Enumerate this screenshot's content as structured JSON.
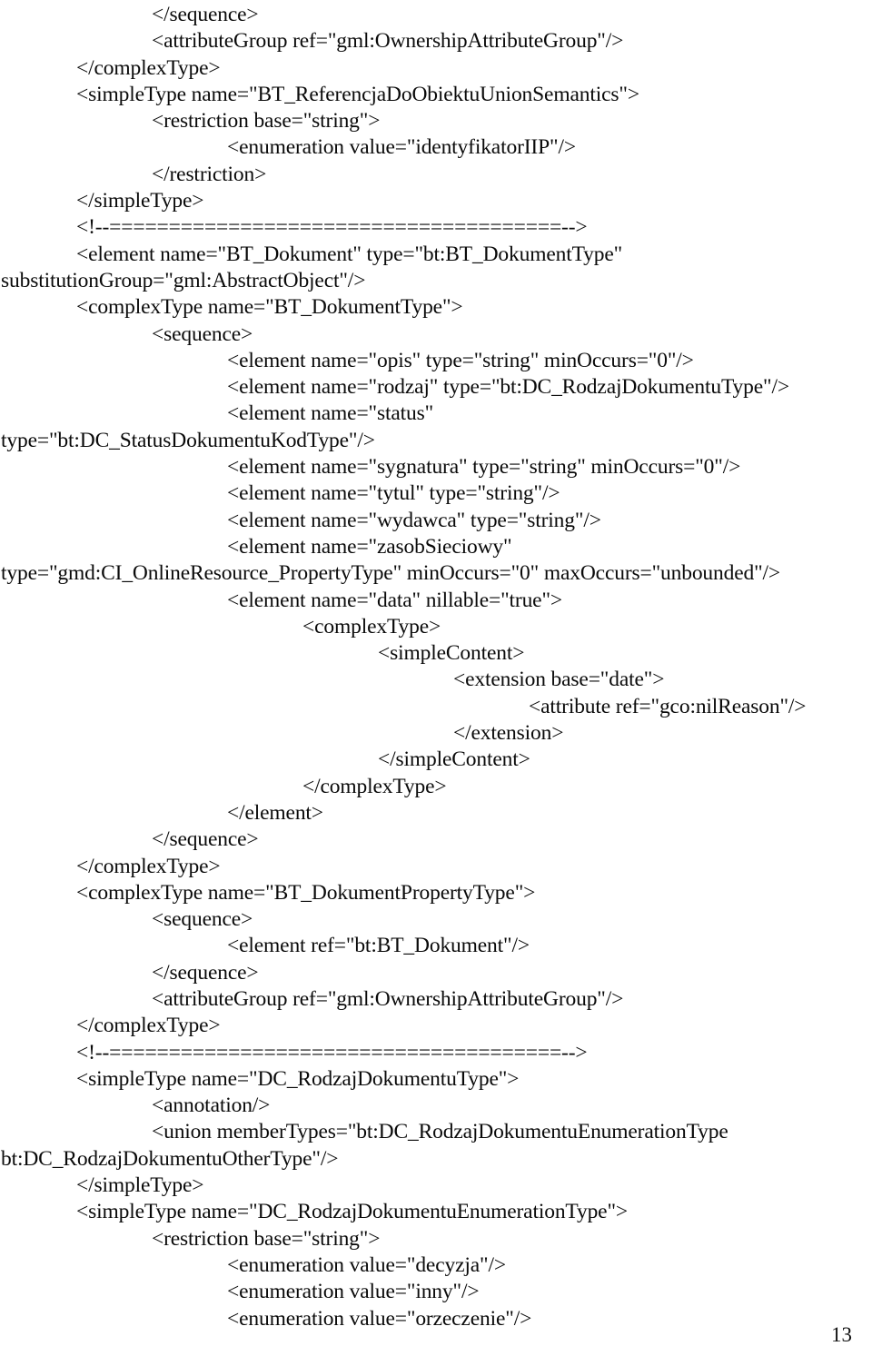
{
  "document": {
    "kind": "scanned-pdf-page",
    "page_number": "13",
    "language": "xml-schema-xsd",
    "lines": [
      {
        "indent": 1,
        "text": "</sequence>"
      },
      {
        "indent": 1,
        "text": "<attributeGroup ref=\"gml:OwnershipAttributeGroup\"/>"
      },
      {
        "indent": 0,
        "text": "</complexType>"
      },
      {
        "indent": 0,
        "text": "<simpleType name=\"BT_ReferencjaDoObiektuUnionSemantics\">"
      },
      {
        "indent": 1,
        "text": "<restriction base=\"string\">"
      },
      {
        "indent": 2,
        "text": "<enumeration value=\"identyfikatorIIP\"/>"
      },
      {
        "indent": 1,
        "text": "</restriction>"
      },
      {
        "indent": 0,
        "text": "</simpleType>"
      },
      {
        "indent": 0,
        "text": "<!--======================================-->"
      },
      {
        "indent": 0,
        "text": "<element name=\"BT_Dokument\" type=\"bt:BT_DokumentType\""
      },
      {
        "indent": -1,
        "text": "substitutionGroup=\"gml:AbstractObject\"/>"
      },
      {
        "indent": 0,
        "text": "<complexType name=\"BT_DokumentType\">"
      },
      {
        "indent": 1,
        "text": "<sequence>"
      },
      {
        "indent": 2,
        "text": "<element name=\"opis\" type=\"string\" minOccurs=\"0\"/>"
      },
      {
        "indent": 2,
        "text": "<element name=\"rodzaj\" type=\"bt:DC_RodzajDokumentuType\"/>"
      },
      {
        "indent": 2,
        "text": "<element name=\"status\""
      },
      {
        "indent": -1,
        "text": "type=\"bt:DC_StatusDokumentuKodType\"/>"
      },
      {
        "indent": 2,
        "text": "<element name=\"sygnatura\" type=\"string\" minOccurs=\"0\"/>"
      },
      {
        "indent": 2,
        "text": "<element name=\"tytul\" type=\"string\"/>"
      },
      {
        "indent": 2,
        "text": "<element name=\"wydawca\" type=\"string\"/>"
      },
      {
        "indent": 2,
        "text": "<element name=\"zasobSieciowy\""
      },
      {
        "indent": -1,
        "text": "type=\"gmd:CI_OnlineResource_PropertyType\" minOccurs=\"0\" maxOccurs=\"unbounded\"/>"
      },
      {
        "indent": 2,
        "text": "<element name=\"data\" nillable=\"true\">"
      },
      {
        "indent": 3,
        "text": "<complexType>"
      },
      {
        "indent": 4,
        "text": "<simpleContent>"
      },
      {
        "indent": 5,
        "text": "<extension base=\"date\">"
      },
      {
        "indent": 6,
        "text": "<attribute ref=\"gco:nilReason\"/>"
      },
      {
        "indent": 5,
        "text": "</extension>"
      },
      {
        "indent": 4,
        "text": "</simpleContent>"
      },
      {
        "indent": 3,
        "text": "</complexType>"
      },
      {
        "indent": 2,
        "text": "</element>"
      },
      {
        "indent": 1,
        "text": "</sequence>"
      },
      {
        "indent": 0,
        "text": "</complexType>"
      },
      {
        "indent": 0,
        "text": "<complexType name=\"BT_DokumentPropertyType\">"
      },
      {
        "indent": 1,
        "text": "<sequence>"
      },
      {
        "indent": 2,
        "text": "<element ref=\"bt:BT_Dokument\"/>"
      },
      {
        "indent": 1,
        "text": "</sequence>"
      },
      {
        "indent": 1,
        "text": "<attributeGroup ref=\"gml:OwnershipAttributeGroup\"/>"
      },
      {
        "indent": 0,
        "text": "</complexType>"
      },
      {
        "indent": 0,
        "text": "<!--======================================-->"
      },
      {
        "indent": 0,
        "text": "<simpleType name=\"DC_RodzajDokumentuType\">"
      },
      {
        "indent": 1,
        "text": "<annotation/>"
      },
      {
        "indent": 1,
        "text": "<union memberTypes=\"bt:DC_RodzajDokumentuEnumerationType"
      },
      {
        "indent": -1,
        "text": "bt:DC_RodzajDokumentuOtherType\"/>"
      },
      {
        "indent": 0,
        "text": "</simpleType>"
      },
      {
        "indent": 0,
        "text": "<simpleType name=\"DC_RodzajDokumentuEnumerationType\">"
      },
      {
        "indent": 1,
        "text": "<restriction base=\"string\">"
      },
      {
        "indent": 2,
        "text": "<enumeration value=\"decyzja\"/>"
      },
      {
        "indent": 2,
        "text": "<enumeration value=\"inny\"/>"
      },
      {
        "indent": 2,
        "text": "<enumeration value=\"orzeczenie\"/>"
      }
    ]
  }
}
